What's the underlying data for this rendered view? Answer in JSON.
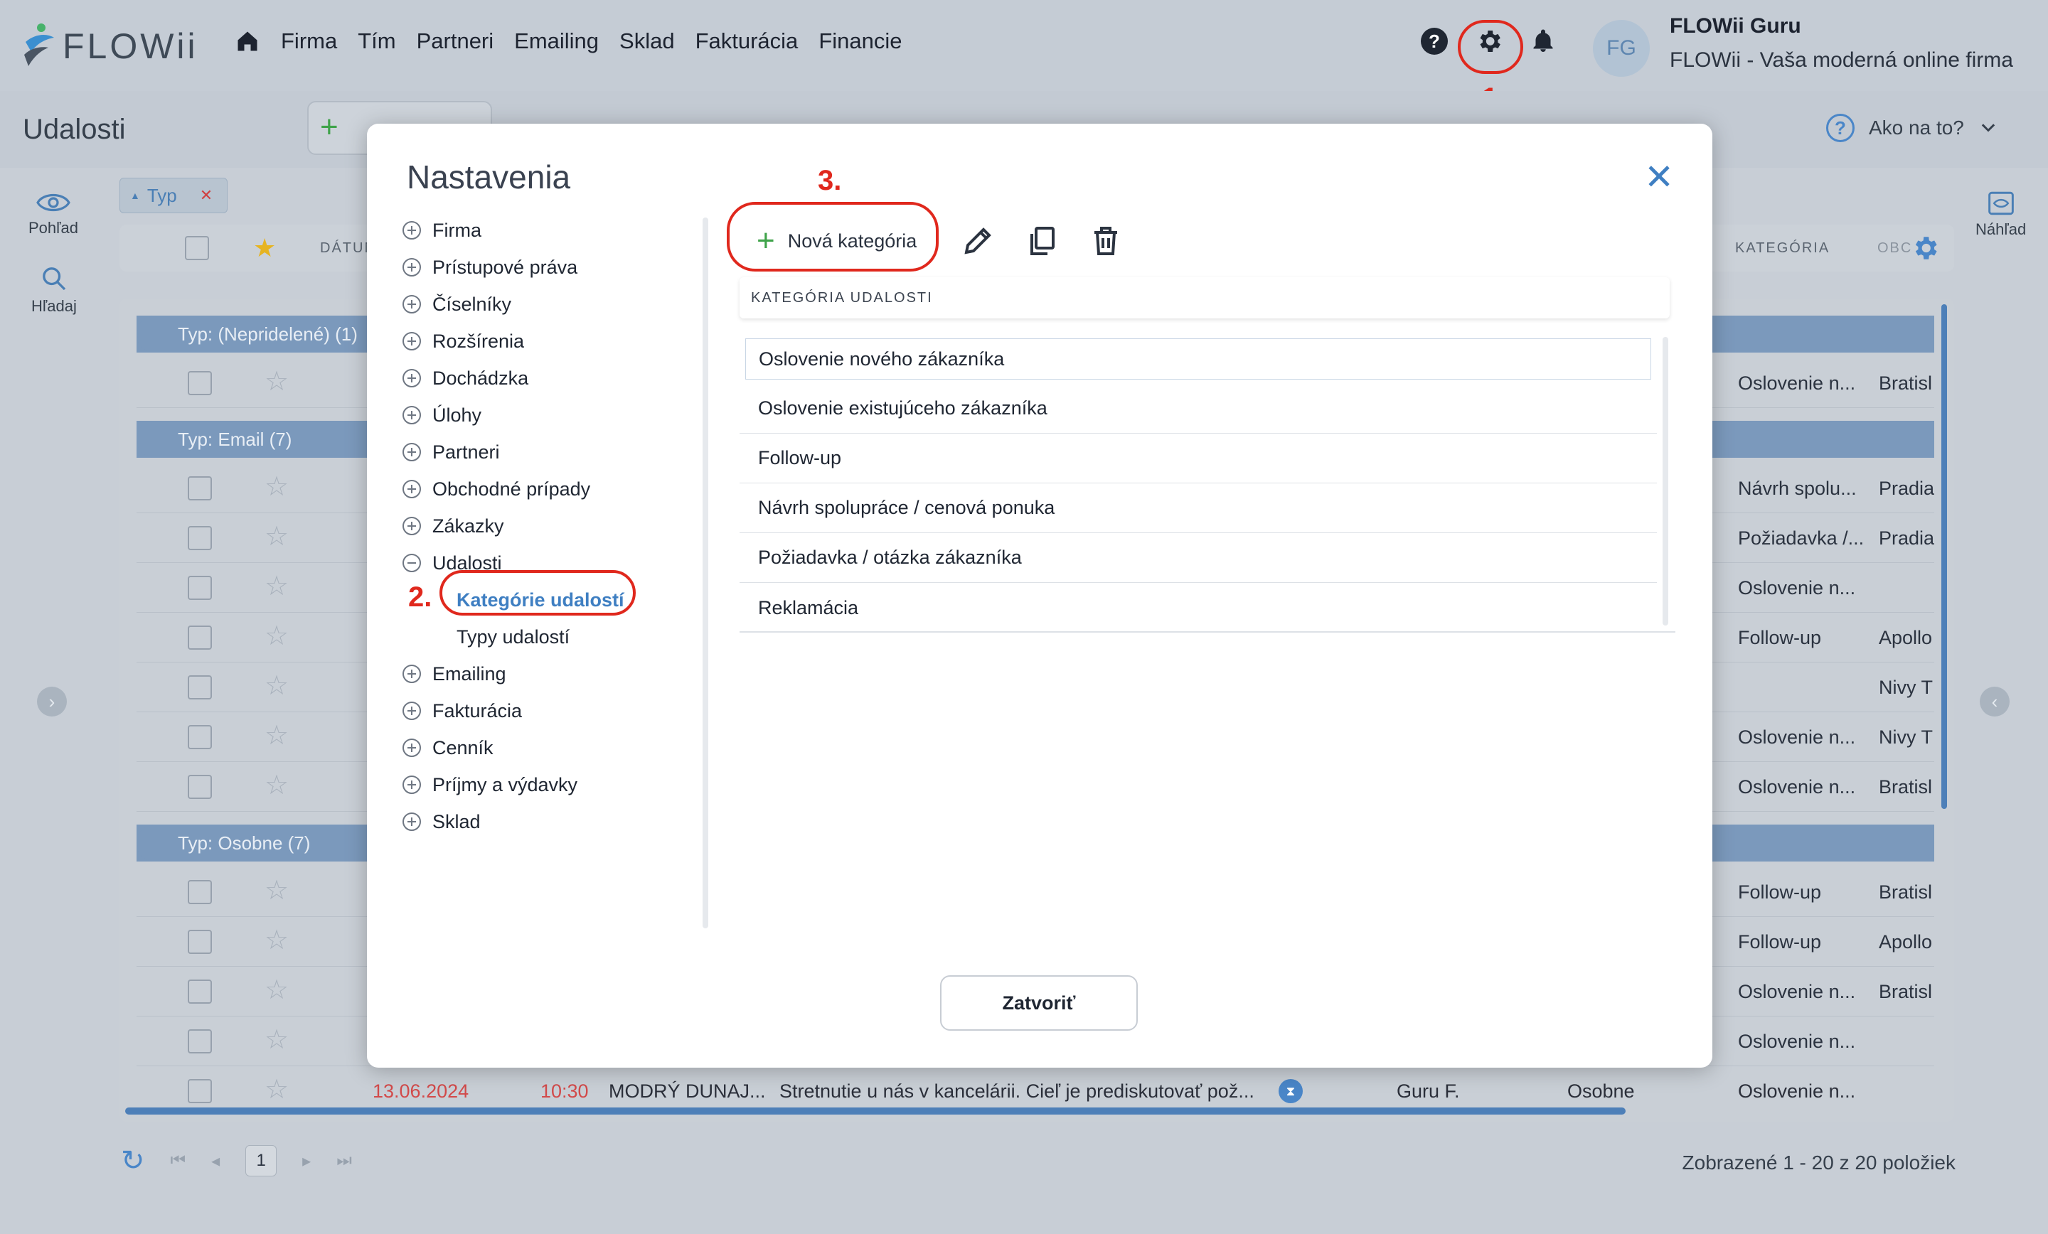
{
  "app": {
    "logo_text": "FLOWii",
    "nav": [
      "Firma",
      "Tím",
      "Partneri",
      "Emailing",
      "Sklad",
      "Fakturácia",
      "Financie"
    ],
    "user_initials": "FG",
    "user_name": "FLOWii Guru",
    "user_subtitle": "FLOWii - Vaša moderná online firma"
  },
  "page": {
    "title": "Udalosti",
    "help_label": "Ako na to?",
    "side_view": "Pohľad",
    "side_search": "Hľadaj",
    "side_preview": "Náhľad",
    "filter_chip": "Typ",
    "col_date": "DÁTUM",
    "col_category": "KATEGÓRIA",
    "col_obc": "OBC"
  },
  "groups": [
    {
      "label": "Typ: (Nepridelené) (1)"
    },
    {
      "label": "Typ: Email (7)"
    },
    {
      "label": "Typ: Osobne (7)"
    }
  ],
  "rows": [
    {
      "c1": "Oslovenie n...",
      "c2": "Bratisl"
    },
    {
      "c1": "Návrh spolu...",
      "c2": "Pradia"
    },
    {
      "c1": "Požiadavka /...",
      "c2": "Pradia"
    },
    {
      "c1": "Oslovenie n...",
      "c2": ""
    },
    {
      "c1": "Follow-up",
      "c2": "Apollo"
    },
    {
      "c1": "",
      "c2": "Nivy T"
    },
    {
      "c1": "Oslovenie n...",
      "c2": "Nivy T"
    },
    {
      "c1": "Oslovenie n...",
      "c2": "Bratisl"
    },
    {
      "c1": "Follow-up",
      "c2": "Bratisl"
    },
    {
      "c1": "Follow-up",
      "c2": "Apollo"
    },
    {
      "c1": "Oslovenie n...",
      "c2": "Bratisl"
    },
    {
      "c1": "Oslovenie n...",
      "c2": ""
    }
  ],
  "last_row": {
    "date": "13.06.2024",
    "time": "10:30",
    "partner": "MODRÝ DUNAJ...",
    "subject": "Stretnutie u nás v kancelárii. Cieľ je prediskutovať pož...",
    "owner": "Guru F.",
    "type": "Osobne",
    "category": "Oslovenie n..."
  },
  "pager": {
    "page": "1",
    "info": "Zobrazené 1 - 20 z 20 položiek"
  },
  "modal": {
    "title": "Nastavenia",
    "tree": [
      {
        "label": "Firma"
      },
      {
        "label": "Prístupové práva"
      },
      {
        "label": "Číselníky"
      },
      {
        "label": "Rozšírenia"
      },
      {
        "label": "Dochádzka"
      },
      {
        "label": "Úlohy"
      },
      {
        "label": "Partneri"
      },
      {
        "label": "Obchodné prípady"
      },
      {
        "label": "Zákazky"
      },
      {
        "label": "Udalosti"
      },
      {
        "label": "Emailing"
      },
      {
        "label": "Fakturácia"
      },
      {
        "label": "Cenník"
      },
      {
        "label": "Príjmy a výdavky"
      },
      {
        "label": "Sklad"
      }
    ],
    "sub_items": [
      "Kategórie udalostí",
      "Typy udalostí"
    ],
    "new_button": "Nová kategória",
    "list_header": "KATEGÓRIA UDALOSTI",
    "categories": [
      "Oslovenie nového zákazníka",
      "Oslovenie existujúceho zákazníka",
      "Follow-up",
      "Návrh spolupráce / cenová ponuka",
      "Požiadavka / otázka zákazníka",
      "Reklamácia"
    ],
    "close_button": "Zatvoriť"
  },
  "annotations": {
    "step1": "1.",
    "step2": "2.",
    "step3": "3.",
    "color": "#e0281d"
  }
}
